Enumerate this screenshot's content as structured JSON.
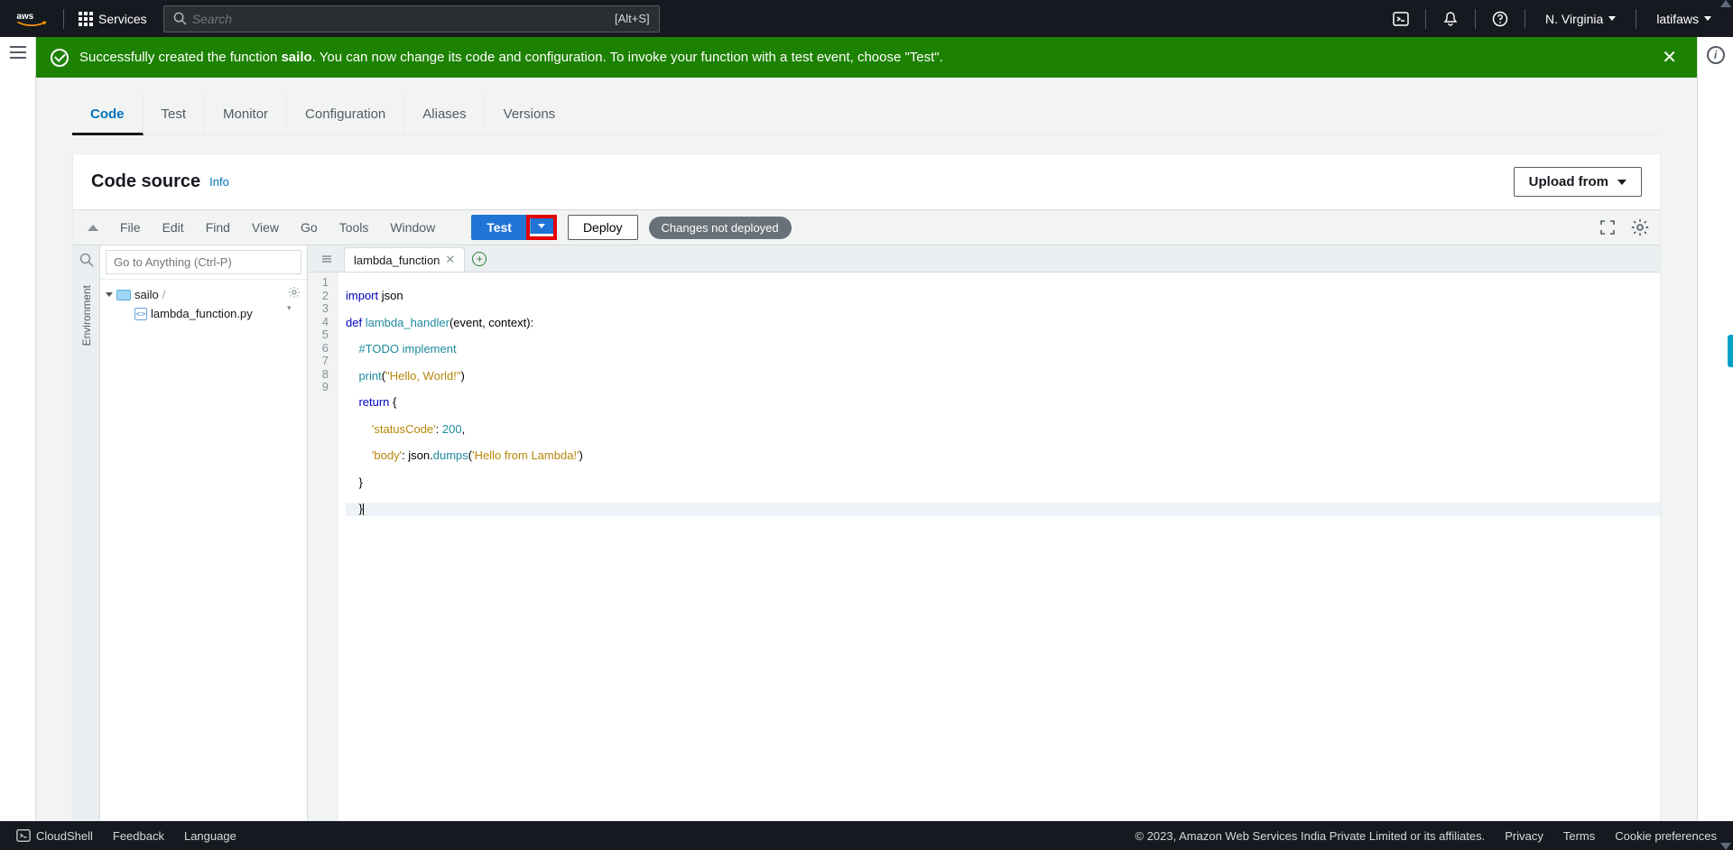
{
  "topnav": {
    "services": "Services",
    "search_placeholder": "Search",
    "search_shortcut": "[Alt+S]",
    "region": "N. Virginia",
    "account": "latifaws"
  },
  "flash": {
    "prefix": "Successfully created the function ",
    "fn_name": "sailo",
    "rest": ". You can now change its code and configuration. To invoke your function with a test event, choose \"Test\"."
  },
  "tabs": {
    "code": "Code",
    "test": "Test",
    "monitor": "Monitor",
    "configuration": "Configuration",
    "aliases": "Aliases",
    "versions": "Versions"
  },
  "card": {
    "title": "Code source",
    "info": "Info",
    "upload_from": "Upload from"
  },
  "ide_menu": {
    "file": "File",
    "edit": "Edit",
    "find": "Find",
    "view": "View",
    "go": "Go",
    "tools": "Tools",
    "window": "Window",
    "test": "Test",
    "deploy": "Deploy",
    "changes": "Changes not deployed"
  },
  "file_panel": {
    "goto_placeholder": "Go to Anything (Ctrl-P)",
    "environment_label": "Environment",
    "root": "sailo",
    "root_suffix": "/",
    "file1": "lambda_function.py"
  },
  "editor": {
    "tab1": "lambda_function",
    "lines": [
      "import json",
      "def lambda_handler(event, context):",
      "    #TODO implement",
      "    print(\"Hello, World!\")",
      "    return {",
      "        'statusCode': 200,",
      "        'body': json.dumps('Hello from Lambda!')",
      "    }",
      "    }"
    ]
  },
  "footer": {
    "cloudshell": "CloudShell",
    "feedback": "Feedback",
    "language": "Language",
    "copyright": "© 2023, Amazon Web Services India Private Limited or its affiliates.",
    "privacy": "Privacy",
    "terms": "Terms",
    "cookies": "Cookie preferences"
  }
}
